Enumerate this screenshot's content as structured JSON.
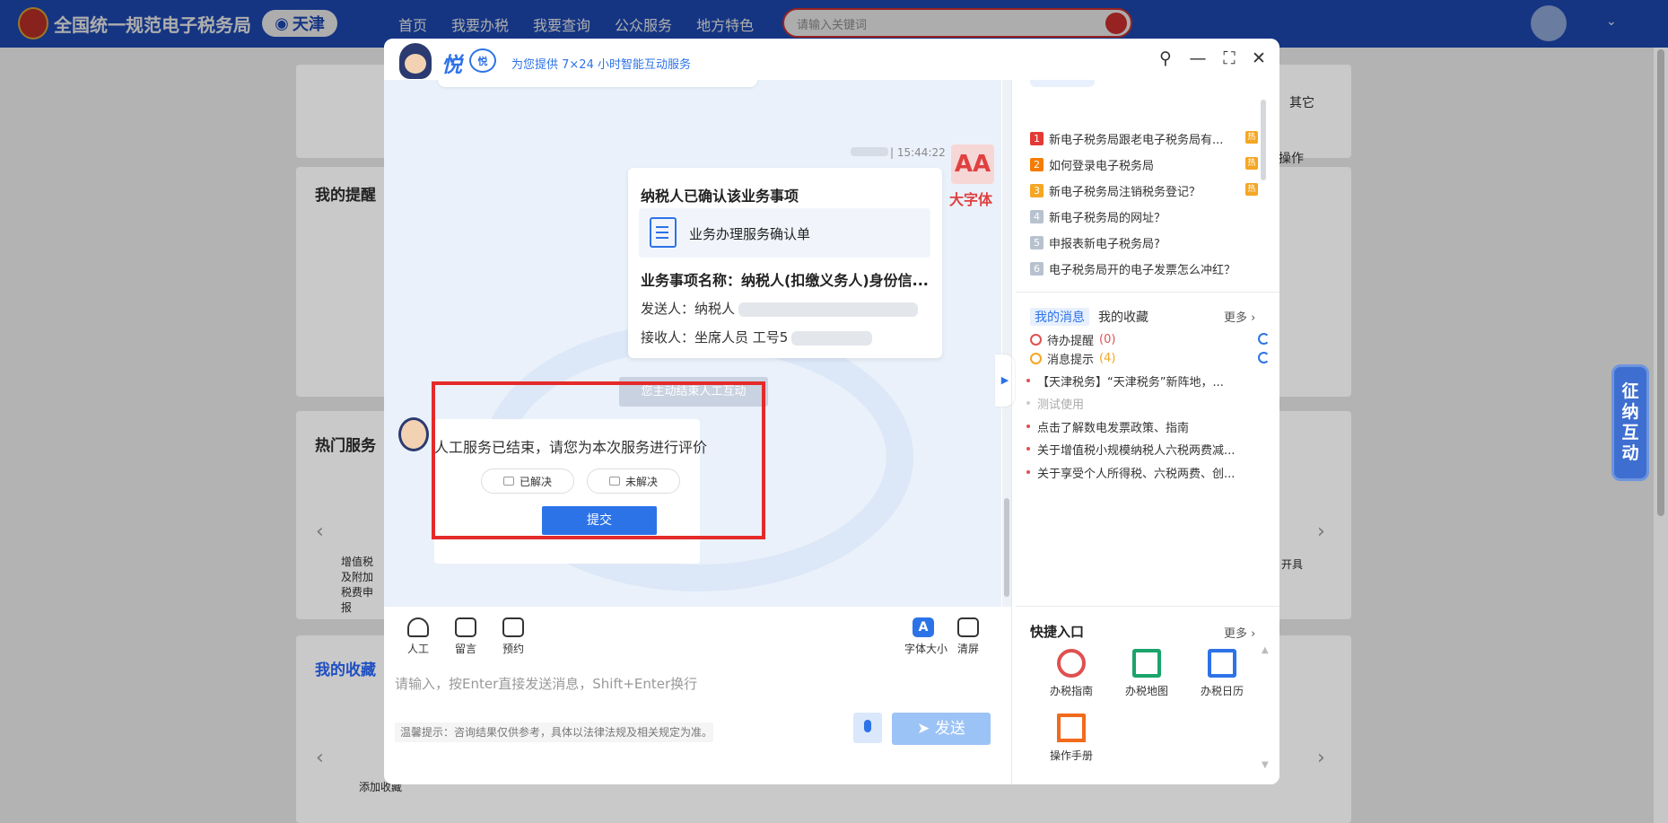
{
  "topbar": {
    "site_title": "全国统一规范电子税务局",
    "city": "天津",
    "nav": [
      "首页",
      "我要办税",
      "我要查询",
      "公众服务",
      "地方特色"
    ],
    "search_placeholder": "请输入关键词",
    "accent": "#1f4fc2"
  },
  "background": {
    "other_tab": "其它",
    "operate": "操作",
    "reminder_title": "我的提醒",
    "hot_services_title": "热门服务",
    "service_vat": "增值税及附加税费申报",
    "service_invoice": "开具",
    "favorites_title": "我的收藏",
    "add_favorite": "添加收藏",
    "side_tab": "征纳互动"
  },
  "dialog": {
    "brand": "悦",
    "brand_badge": "悦",
    "subtitle": "为您提供 7×24 小时智能互动服务",
    "timestamp": "| 15:44:22",
    "big_font_label": "大字体",
    "confirm_card": {
      "title": "纳税人已确认该业务事项",
      "doc_label": "业务办理服务确认单",
      "item_name": "业务事项名称：纳税人(扣缴义务人)身份信...",
      "sender": "发送人：纳税人",
      "receiver": "接收人：坐席人员 工号5"
    },
    "end_notice": "您主动结束人工互动",
    "rating": {
      "prompt": "人工服务已结束，请您为本次服务进行评价",
      "resolved": "已解决",
      "unresolved": "未解决",
      "submit": "提交"
    },
    "toolbar": {
      "human": "人工",
      "message": "留言",
      "booking": "预约",
      "font_size": "字体大小",
      "clear": "清屏"
    },
    "input_placeholder": "请输入，按Enter直接发送消息，Shift+Enter换行",
    "disclaimer": "温馨提示：咨询结果仅供参考，具体以法律法规及相关规定为准。",
    "send": "发送"
  },
  "right_panel": {
    "hot_questions": [
      {
        "num": "1",
        "text": "新电子税务局跟老电子税务局有...",
        "hot": true,
        "color": "#e53935"
      },
      {
        "num": "2",
        "text": "如何登录电子税务局",
        "hot": true,
        "color": "#f57c00"
      },
      {
        "num": "3",
        "text": "新电子税务局注销税务登记？",
        "hot": true,
        "color": "#f5a623"
      },
      {
        "num": "4",
        "text": "新电子税务局的网址？",
        "hot": false,
        "color": "#b8c2cf"
      },
      {
        "num": "5",
        "text": "申报表新电子税务局?",
        "hot": false,
        "color": "#b8c2cf"
      },
      {
        "num": "6",
        "text": "电子税务局开的电子发票怎么冲红？",
        "hot": false,
        "color": "#b8c2cf"
      }
    ],
    "hot_badge": "热",
    "msg_tab_active": "我的消息",
    "msg_tab_fav": "我的收藏",
    "more": "更多",
    "todo_label": "待办提醒",
    "todo_count": "(0)",
    "notice_label": "消息提示",
    "notice_count": "(4)",
    "messages": [
      {
        "text": "【天津税务】“天津税务”新阵地，...",
        "grey": false
      },
      {
        "text": "测试使用",
        "grey": true
      },
      {
        "text": "点击了解数电发票政策、指南",
        "grey": false
      },
      {
        "text": "关于增值税小规模纳税人六税两费减...",
        "grey": false
      },
      {
        "text": "关于享受个人所得税、六税两费、创...",
        "grey": false
      }
    ],
    "quick_title": "快捷入口",
    "quick_more": "更多",
    "quick": [
      "办税指南",
      "办税地图",
      "办税日历",
      "操作手册"
    ]
  }
}
